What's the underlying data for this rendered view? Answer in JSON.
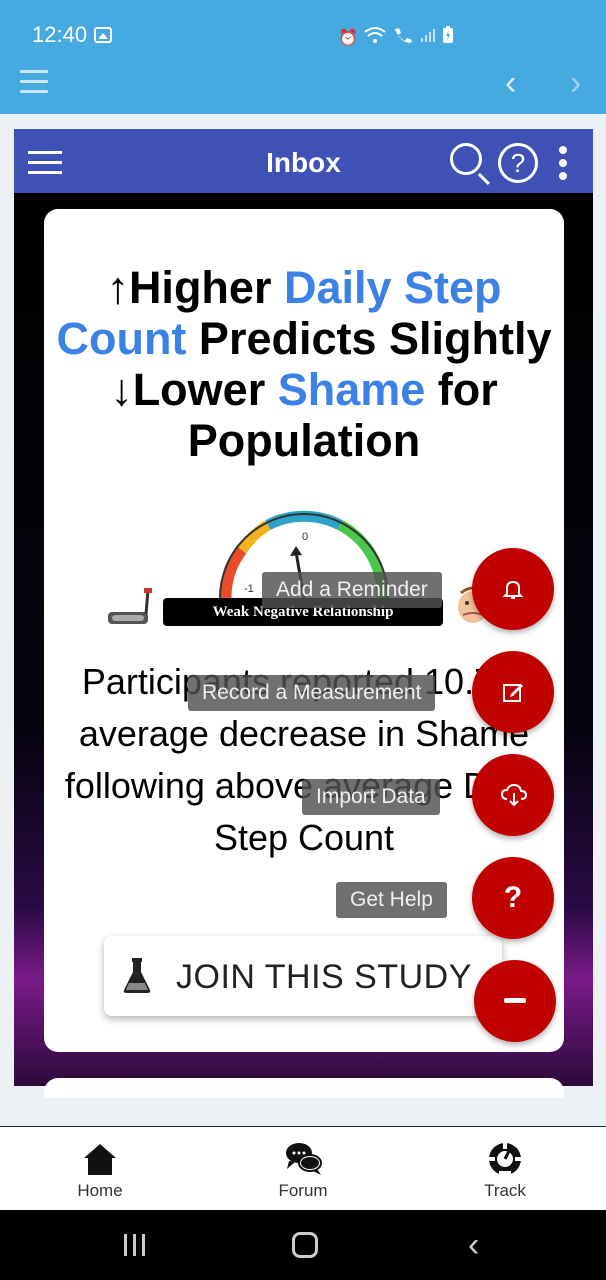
{
  "status_bar": {
    "time": "12:40"
  },
  "inbox_bar": {
    "title": "Inbox"
  },
  "card": {
    "headline": {
      "part1": "↑Higher ",
      "part2": "Daily Step Count",
      "part3": " Predicts Slightly ↓Lower ",
      "part4": "Shame",
      "part5": " for Population"
    },
    "gauge": {
      "tick_zero": "0",
      "tick_minus_one": "-1",
      "label": "Weak Negative Relationship"
    },
    "body": "Participants reported 10.7% average decrease in Shame following above average Daily Step Count",
    "join_button": "JOIN THIS STUDY"
  },
  "fab_menu": {
    "reminder": "Add a Reminder",
    "measurement": "Record a Measurement",
    "import": "Import Data",
    "help": "Get Help",
    "help_symbol": "?"
  },
  "bottom_nav": {
    "home": "Home",
    "forum": "Forum",
    "track": "Track"
  },
  "colors": {
    "status_bar": "#46a9e0",
    "inbox_bar": "#3f51b5",
    "accent_blue": "#3c82e6",
    "fab_red": "#c10000"
  }
}
